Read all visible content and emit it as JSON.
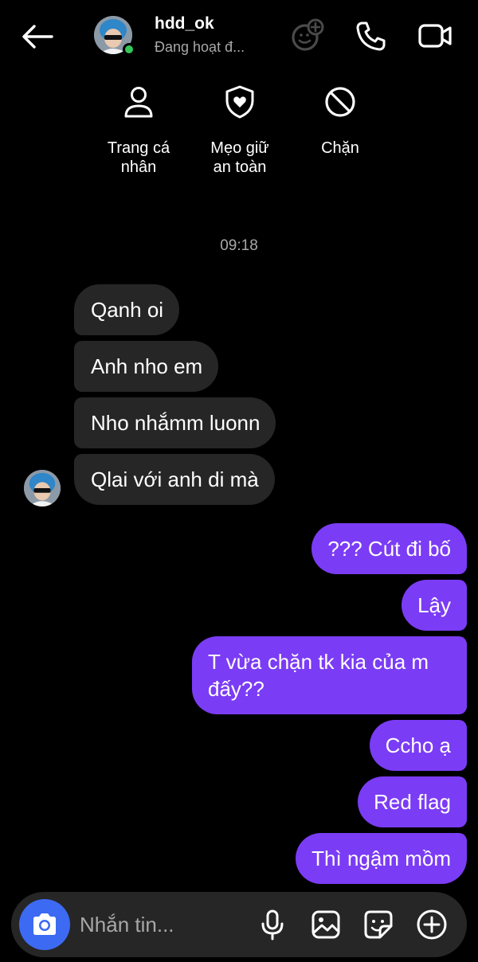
{
  "header": {
    "contact_name": "hdd_ok",
    "contact_status": "Đang hoạt đ...",
    "icons": [
      "back-arrow-icon",
      "effects-icon",
      "phone-icon",
      "video-icon"
    ]
  },
  "quick_actions": [
    {
      "label": "Trang cá\nnhân",
      "icon": "person-icon"
    },
    {
      "label": "Mẹo giữ\nan toàn",
      "icon": "shield-heart-icon"
    },
    {
      "label": "Chặn",
      "icon": "block-icon"
    }
  ],
  "timestamp": "09:18",
  "messages_in": [
    {
      "text": "Qanh oi"
    },
    {
      "text": "Anh nho em"
    },
    {
      "text": "Nho nhắmm luonn"
    },
    {
      "text": "Qlai với anh di mà"
    }
  ],
  "messages_out": [
    {
      "text": "??? Cút đi bố"
    },
    {
      "text": "Lậy"
    },
    {
      "text": "T vừa chặn tk kia của m\nđấy??"
    },
    {
      "text": "Ccho ạ"
    },
    {
      "text": "Red flag"
    },
    {
      "text": "Thì ngậm mồm"
    }
  ],
  "composer": {
    "placeholder": "Nhắn tin...",
    "icons": [
      "camera-icon",
      "microphone-icon",
      "gallery-icon",
      "sticker-icon",
      "plus-icon"
    ]
  },
  "colors": {
    "background": "#000000",
    "incoming_bubble": "#262626",
    "outgoing_bubble": "#7b3cf5",
    "camera_button": "#3d6af2",
    "online": "#34c759",
    "secondary_text": "#a8a8a8"
  }
}
